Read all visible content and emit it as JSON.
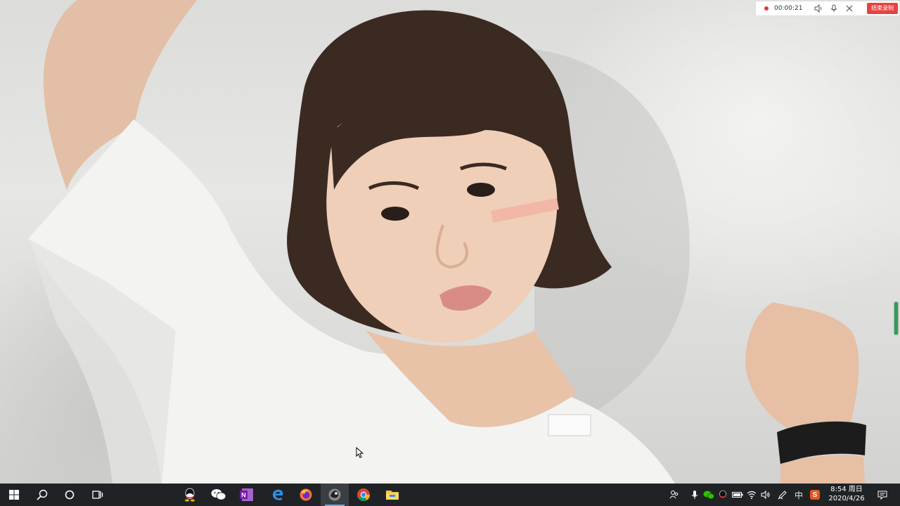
{
  "recording_toolbar": {
    "elapsed_time": "00:00:21",
    "end_button_label": "结束录制",
    "icons": [
      "record-dot-icon",
      "speaker-icon",
      "microphone-icon",
      "close-icon"
    ],
    "accent_color": "#e64340"
  },
  "wallpaper": {
    "subject": "photo-wallpaper"
  },
  "taskbar": {
    "background_color": "#1f2326",
    "left_buttons": [
      "start-icon",
      "search-icon",
      "cortana-icon",
      "task-view-icon"
    ],
    "pinned_apps": [
      "qq-icon",
      "wechat-icon",
      "onenote-icon",
      "edge-icon",
      "firefox-icon",
      "photo-app-icon",
      "chrome-icon",
      "file-explorer-icon"
    ],
    "active_app": "photo-app-icon",
    "tray_icons": [
      "people-icon",
      "mic-tray-icon",
      "wechat-tray-icon",
      "qq-tray-icon",
      "battery-icon",
      "wifi-icon",
      "volume-icon",
      "pen-icon",
      "ime-icon",
      "sogou-icon"
    ],
    "ime_label": "中",
    "sogou_label": "S",
    "clock": {
      "time": "8:54 周日",
      "date": "2020/4/26"
    },
    "notification_icon": "action-center-icon"
  }
}
